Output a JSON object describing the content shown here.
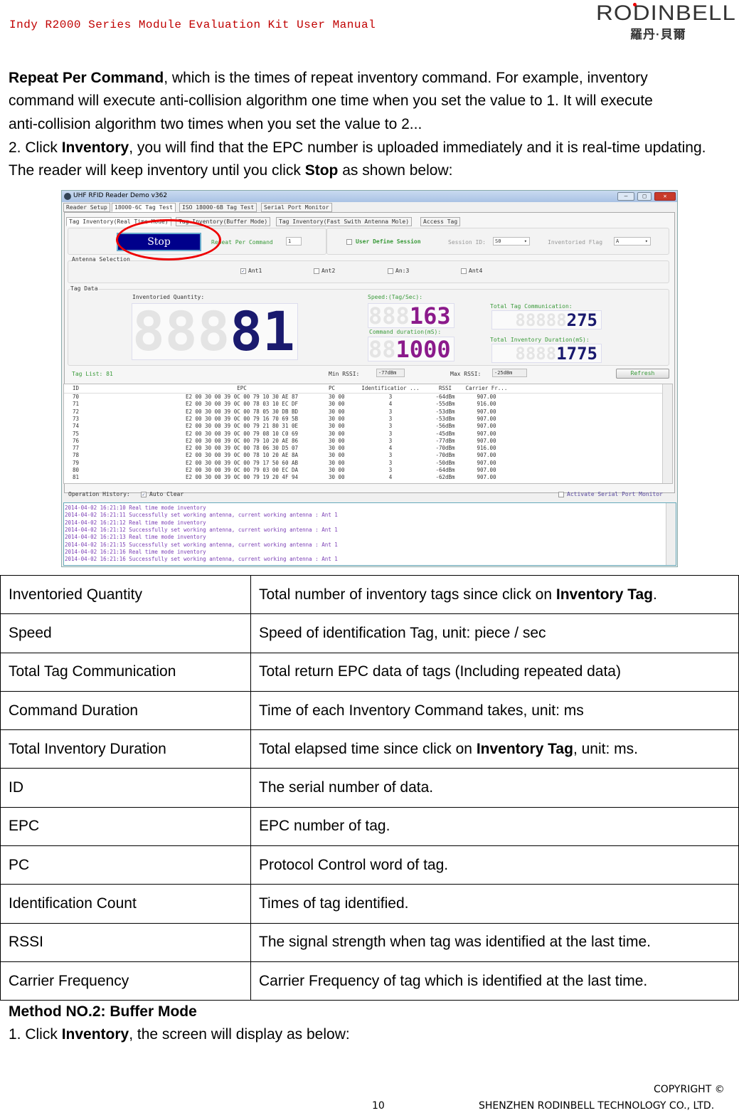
{
  "header": {
    "title": "Indy R2000 Series Module Evaluation Kit User Manual",
    "logo_text": "RODINBELL",
    "logo_cn": "羅丹·貝爾"
  },
  "intro": {
    "l1_bold": "Repeat Per Command",
    "l1": ", which is the times of repeat inventory command. For example, inventory",
    "l2": "command will execute anti-collision algorithm one time when you set the value to 1. It will execute",
    "l3": "anti-collision algorithm two times when you set the value to 2...",
    "l4_a": "2. Click ",
    "l4_bold": "Inventory",
    "l4_b": ", you will find that the EPC number is uploaded immediately and it is real-time updating.",
    "l5_a": "The reader will keep inventory until you click ",
    "l5_bold": "Stop",
    "l5_b": " as shown below:"
  },
  "app": {
    "title": "UHF RFID Reader Demo v362",
    "window_buttons": [
      "minimize-icon",
      "maximize-icon",
      "close-icon"
    ],
    "tabs": [
      "Reader Setup",
      "18000-6C Tag Test",
      "ISO 18000-6B Tag Test",
      "Serial Port Monitor"
    ],
    "active_tab": "18000-6C Tag Test",
    "subtabs": [
      "Tag Inventory(Real Time Mode)",
      "Tag Inventory(Buffer Mode)",
      "Tag Inventory(Fast Swith Antenna Mole)",
      "Access Tag"
    ],
    "stop_label": "Stop",
    "repeat_label": "Repeat Per Command",
    "repeat_value": "1",
    "user_define_session": "User Define Session",
    "session_id_label": "Session ID:",
    "session_id_value": "S0",
    "inventoried_flag_label": "Inventoried Flag",
    "inventoried_flag_value": "A",
    "antenna_selection": "Antenna Selection",
    "antennas": [
      {
        "label": "Ant1",
        "checked": true
      },
      {
        "label": "Ant2",
        "checked": false
      },
      {
        "label": "An:3",
        "checked": false
      },
      {
        "label": "Ant4",
        "checked": false
      }
    ],
    "tag_data": "Tag Data",
    "inventoried_quantity_label": "Inventoried Quantity:",
    "inventoried_quantity": "81",
    "speed_label": "Speed:(Tag/Sec):",
    "speed": "163",
    "command_duration_label": "Command duration(mS):",
    "command_duration": "1000",
    "total_tag_comm_label": "Total Tag Communication:",
    "total_tag_comm": "275",
    "total_inv_duration_label": "Total Inventory Duration(mS):",
    "total_inv_duration": "1775",
    "tag_list": "Tag List: 81",
    "min_rssi_label": "Min RSSI:",
    "min_rssi": "-77dBm",
    "max_rssi_label": "Max RSSI:",
    "max_rssi": "-25dBm",
    "refresh": "Refresh",
    "columns": [
      "ID",
      "EPC",
      "PC",
      "Identificatior ...",
      "RSSI",
      "Carrier Fr..."
    ],
    "rows": [
      [
        "70",
        "E2 00 30 00 39 0C 00 79 10 30 AE 87",
        "30 00",
        "3",
        "-64dBm",
        "907.00"
      ],
      [
        "71",
        "E2 00 30 00 39 0C 00 78 03 10 EC DF",
        "30 00",
        "4",
        "-55dBm",
        "916.00"
      ],
      [
        "72",
        "E2 00 30 00 39 0C 00 78 05 30 DB BD",
        "30 00",
        "3",
        "-53dBm",
        "907.00"
      ],
      [
        "73",
        "E2 00 30 00 39 0C 00 79 16 70 69 5B",
        "30 00",
        "3",
        "-53dBm",
        "907.00"
      ],
      [
        "74",
        "E2 00 30 00 39 0C 00 79 21 80 31 0E",
        "30 00",
        "3",
        "-56dBm",
        "907.00"
      ],
      [
        "75",
        "E2 00 30 00 39 0C 00 79 08 10 C0 69",
        "30 00",
        "3",
        "-45dBm",
        "907.00"
      ],
      [
        "76",
        "E2 00 30 00 39 0C 00 79 10 20 AE 86",
        "30 00",
        "3",
        "-77dBm",
        "907.00"
      ],
      [
        "77",
        "E2 00 30 00 39 0C 00 78 06 30 D5 07",
        "30 00",
        "4",
        "-70dBm",
        "916.00"
      ],
      [
        "78",
        "E2 00 30 00 39 0C 00 78 10 20 AE 8A",
        "30 00",
        "3",
        "-70dBm",
        "907.00"
      ],
      [
        "79",
        "E2 00 30 00 39 0C 00 79 17 50 60 AB",
        "30 00",
        "3",
        "-50dBm",
        "907.00"
      ],
      [
        "80",
        "E2 00 30 00 39 0C 00 79 03 00 EC DA",
        "30 00",
        "3",
        "-64dBm",
        "907.00"
      ],
      [
        "81",
        "E2 00 30 00 39 0C 00 79 19 20 4F 94",
        "30 00",
        "4",
        "-62dBm",
        "907.00"
      ]
    ],
    "operation_history": "Operation History:",
    "auto_clear": "Auto Clear",
    "auto_clear_checked": true,
    "activate_monitor": "Activate Serial Port Monitor",
    "log": [
      "2014-04-02 16:21:10 Real time mode inventory",
      "2014-04-02 16:21:11 Successfully set working antenna, current working antenna : Ant 1",
      "2014-04-02 16:21:12 Real time mode inventory",
      "2014-04-02 16:21:12 Successfully set working antenna, current working antenna : Ant 1",
      "2014-04-02 16:21:13 Real time mode inventory",
      "2014-04-02 16:21:15 Successfully set working antenna, current working antenna : Ant 1",
      "2014-04-02 16:21:16 Real time mode inventory",
      "2014-04-02 16:21:16 Successfully set working antenna, current working antenna : Ant 1"
    ],
    "colors": {
      "stop_button": "#00008b",
      "green_label": "#3a9a3a",
      "log_text": "#7b3fb5",
      "seg_blue": "#1a1a6e",
      "seg_purple": "#8b1a8b",
      "highlight_ellipse": "#e00000"
    }
  },
  "table": [
    {
      "term": "Inventoried Quantity",
      "desc": "Total number of inventory tags since click on ",
      "bold": "Inventory Tag",
      "after": "."
    },
    {
      "term": "Speed",
      "desc": "Speed of identification Tag, unit: piece / sec"
    },
    {
      "term": "Total Tag Communication",
      "desc": "Total return EPC data of tags (Including repeated data)"
    },
    {
      "term": "Command Duration",
      "desc": "Time of each Inventory Command takes, unit: ms"
    },
    {
      "term": "Total Inventory Duration",
      "desc": "Total elapsed time since click on ",
      "bold": "Inventory Tag",
      "after": ", unit: ms."
    },
    {
      "term": "ID",
      "desc": "The serial number of data."
    },
    {
      "term": "EPC",
      "desc": "EPC number of tag."
    },
    {
      "term": "PC",
      "desc": "Protocol Control word of tag."
    },
    {
      "term": "Identification Count",
      "desc": "Times of tag identified."
    },
    {
      "term": "RSSI",
      "desc": "The signal strength when tag was identified at the last time."
    },
    {
      "term": "Carrier Frequency",
      "desc": "Carrier Frequency of tag which is identified at the last time."
    }
  ],
  "method2": {
    "heading": "Method NO.2: Buffer Mode",
    "l_a": "1. Click ",
    "l_bold": "Inventory",
    "l_b": ", the screen will display as below:"
  },
  "footer": {
    "page": "10",
    "copyright": "COPYRIGHT ©",
    "company": "SHENZHEN RODINBELL TECHNOLOGY CO., LTD."
  }
}
